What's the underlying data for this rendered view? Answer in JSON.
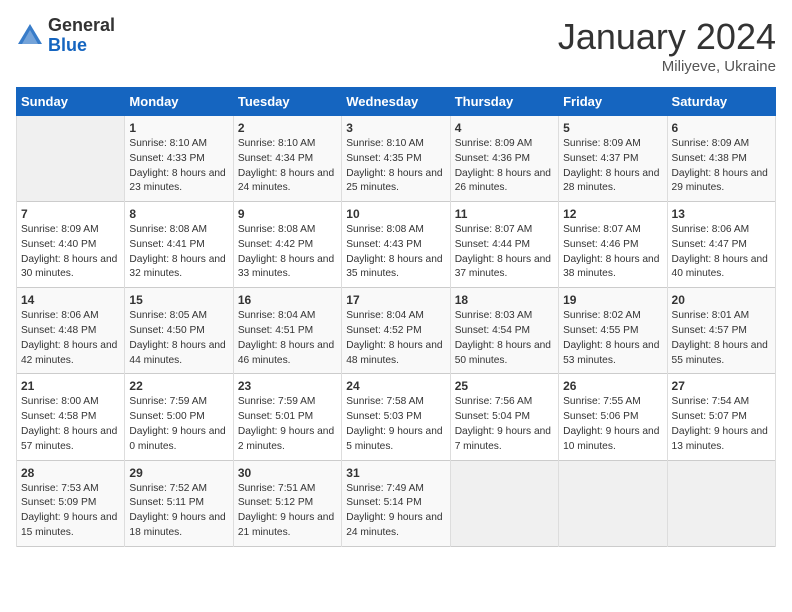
{
  "header": {
    "logo_general": "General",
    "logo_blue": "Blue",
    "month_title": "January 2024",
    "subtitle": "Miliyeve, Ukraine"
  },
  "days_of_week": [
    "Sunday",
    "Monday",
    "Tuesday",
    "Wednesday",
    "Thursday",
    "Friday",
    "Saturday"
  ],
  "weeks": [
    [
      {
        "num": "",
        "sunrise": "",
        "sunset": "",
        "daylight": ""
      },
      {
        "num": "1",
        "sunrise": "8:10 AM",
        "sunset": "4:33 PM",
        "daylight": "8 hours and 23 minutes."
      },
      {
        "num": "2",
        "sunrise": "8:10 AM",
        "sunset": "4:34 PM",
        "daylight": "8 hours and 24 minutes."
      },
      {
        "num": "3",
        "sunrise": "8:10 AM",
        "sunset": "4:35 PM",
        "daylight": "8 hours and 25 minutes."
      },
      {
        "num": "4",
        "sunrise": "8:09 AM",
        "sunset": "4:36 PM",
        "daylight": "8 hours and 26 minutes."
      },
      {
        "num": "5",
        "sunrise": "8:09 AM",
        "sunset": "4:37 PM",
        "daylight": "8 hours and 28 minutes."
      },
      {
        "num": "6",
        "sunrise": "8:09 AM",
        "sunset": "4:38 PM",
        "daylight": "8 hours and 29 minutes."
      }
    ],
    [
      {
        "num": "7",
        "sunrise": "8:09 AM",
        "sunset": "4:40 PM",
        "daylight": "8 hours and 30 minutes."
      },
      {
        "num": "8",
        "sunrise": "8:08 AM",
        "sunset": "4:41 PM",
        "daylight": "8 hours and 32 minutes."
      },
      {
        "num": "9",
        "sunrise": "8:08 AM",
        "sunset": "4:42 PM",
        "daylight": "8 hours and 33 minutes."
      },
      {
        "num": "10",
        "sunrise": "8:08 AM",
        "sunset": "4:43 PM",
        "daylight": "8 hours and 35 minutes."
      },
      {
        "num": "11",
        "sunrise": "8:07 AM",
        "sunset": "4:44 PM",
        "daylight": "8 hours and 37 minutes."
      },
      {
        "num": "12",
        "sunrise": "8:07 AM",
        "sunset": "4:46 PM",
        "daylight": "8 hours and 38 minutes."
      },
      {
        "num": "13",
        "sunrise": "8:06 AM",
        "sunset": "4:47 PM",
        "daylight": "8 hours and 40 minutes."
      }
    ],
    [
      {
        "num": "14",
        "sunrise": "8:06 AM",
        "sunset": "4:48 PM",
        "daylight": "8 hours and 42 minutes."
      },
      {
        "num": "15",
        "sunrise": "8:05 AM",
        "sunset": "4:50 PM",
        "daylight": "8 hours and 44 minutes."
      },
      {
        "num": "16",
        "sunrise": "8:04 AM",
        "sunset": "4:51 PM",
        "daylight": "8 hours and 46 minutes."
      },
      {
        "num": "17",
        "sunrise": "8:04 AM",
        "sunset": "4:52 PM",
        "daylight": "8 hours and 48 minutes."
      },
      {
        "num": "18",
        "sunrise": "8:03 AM",
        "sunset": "4:54 PM",
        "daylight": "8 hours and 50 minutes."
      },
      {
        "num": "19",
        "sunrise": "8:02 AM",
        "sunset": "4:55 PM",
        "daylight": "8 hours and 53 minutes."
      },
      {
        "num": "20",
        "sunrise": "8:01 AM",
        "sunset": "4:57 PM",
        "daylight": "8 hours and 55 minutes."
      }
    ],
    [
      {
        "num": "21",
        "sunrise": "8:00 AM",
        "sunset": "4:58 PM",
        "daylight": "8 hours and 57 minutes."
      },
      {
        "num": "22",
        "sunrise": "7:59 AM",
        "sunset": "5:00 PM",
        "daylight": "9 hours and 0 minutes."
      },
      {
        "num": "23",
        "sunrise": "7:59 AM",
        "sunset": "5:01 PM",
        "daylight": "9 hours and 2 minutes."
      },
      {
        "num": "24",
        "sunrise": "7:58 AM",
        "sunset": "5:03 PM",
        "daylight": "9 hours and 5 minutes."
      },
      {
        "num": "25",
        "sunrise": "7:56 AM",
        "sunset": "5:04 PM",
        "daylight": "9 hours and 7 minutes."
      },
      {
        "num": "26",
        "sunrise": "7:55 AM",
        "sunset": "5:06 PM",
        "daylight": "9 hours and 10 minutes."
      },
      {
        "num": "27",
        "sunrise": "7:54 AM",
        "sunset": "5:07 PM",
        "daylight": "9 hours and 13 minutes."
      }
    ],
    [
      {
        "num": "28",
        "sunrise": "7:53 AM",
        "sunset": "5:09 PM",
        "daylight": "9 hours and 15 minutes."
      },
      {
        "num": "29",
        "sunrise": "7:52 AM",
        "sunset": "5:11 PM",
        "daylight": "9 hours and 18 minutes."
      },
      {
        "num": "30",
        "sunrise": "7:51 AM",
        "sunset": "5:12 PM",
        "daylight": "9 hours and 21 minutes."
      },
      {
        "num": "31",
        "sunrise": "7:49 AM",
        "sunset": "5:14 PM",
        "daylight": "9 hours and 24 minutes."
      },
      {
        "num": "",
        "sunrise": "",
        "sunset": "",
        "daylight": ""
      },
      {
        "num": "",
        "sunrise": "",
        "sunset": "",
        "daylight": ""
      },
      {
        "num": "",
        "sunrise": "",
        "sunset": "",
        "daylight": ""
      }
    ]
  ],
  "labels": {
    "sunrise_prefix": "Sunrise: ",
    "sunset_prefix": "Sunset: ",
    "daylight_prefix": "Daylight: "
  }
}
